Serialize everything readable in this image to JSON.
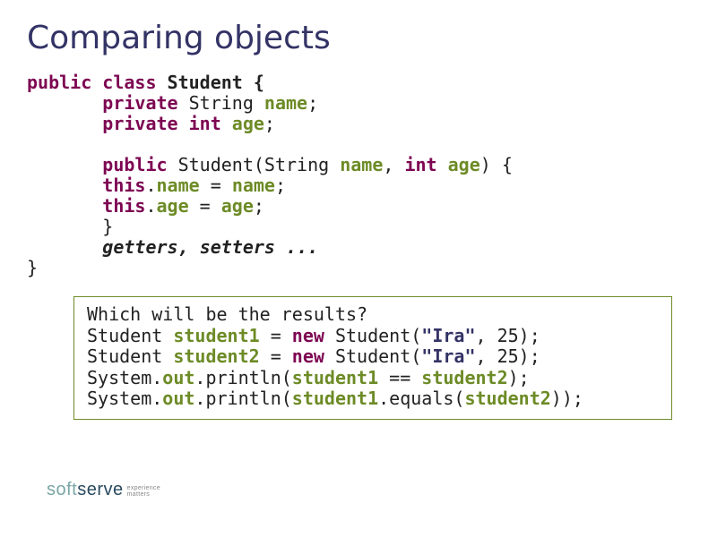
{
  "title": "Comparing objects",
  "code": {
    "l1": {
      "a": "public class",
      "b": " Student {"
    },
    "l2": {
      "pad": "       ",
      "a": "private",
      "b": " String ",
      "c": "name",
      "d": ";"
    },
    "l3": {
      "pad": "       ",
      "a": "private int",
      "b": " ",
      "c": "age",
      "d": ";"
    },
    "blank1": "",
    "l4": {
      "pad": "       ",
      "a": "public",
      "b": " Student(String ",
      "c": "name",
      "d": ", ",
      "e": "int",
      "f": " ",
      "g": "age",
      "h": ") {"
    },
    "l5": {
      "pad": "       ",
      "a": "this",
      "b": ".",
      "c": "name",
      "d": " = ",
      "e": "name",
      "f": ";"
    },
    "l6": {
      "pad": "       ",
      "a": "this",
      "b": ".",
      "c": "age",
      "d": " = ",
      "e": "age",
      "f": ";"
    },
    "l7": {
      "pad": "       ",
      "a": "}"
    },
    "l8": {
      "pad": "       ",
      "a": "getters",
      "b": ", ",
      "c": "setters",
      "d": " ..."
    },
    "l9": {
      "a": "}"
    }
  },
  "question": {
    "q1": "Which will be the results?",
    "q2": {
      "a": "Student ",
      "b": "student1",
      "c": " = ",
      "d": "new",
      "e": " Student(",
      "f": "\"Ira\"",
      "g": ", 25);"
    },
    "q3": {
      "a": "Student ",
      "b": "student2",
      "c": " = ",
      "d": "new",
      "e": " Student(",
      "f": "\"Ira\"",
      "g": ", 25);"
    },
    "q4": {
      "a": "System.",
      "b": "out",
      "c": ".println(",
      "d": "student1",
      "e": " == ",
      "f": "student2",
      "g": ");"
    },
    "q5": {
      "a": "System.",
      "b": "out",
      "c": ".println(",
      "d": "student1",
      "e": ".equals(",
      "f": "student2",
      "g": "));"
    }
  },
  "logo": {
    "soft": "soft",
    "serve": "serve",
    "tag1": "experience",
    "tag2": "matters"
  }
}
